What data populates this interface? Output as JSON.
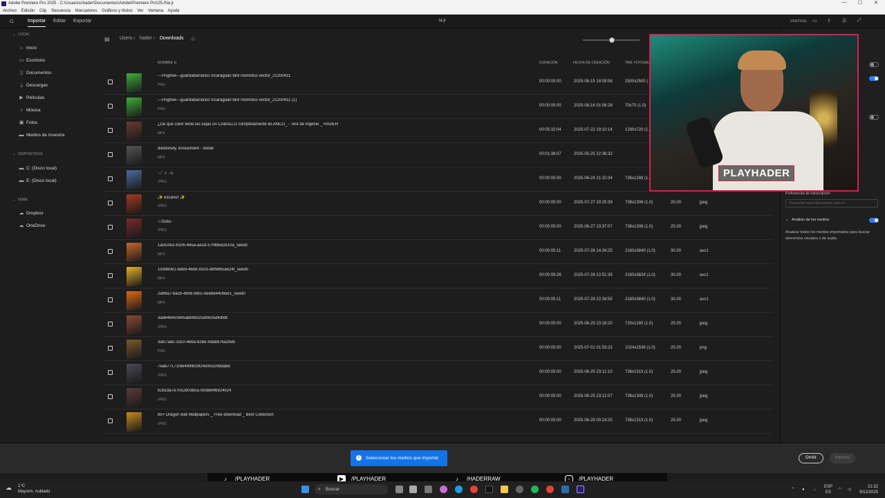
{
  "window": {
    "title": "Adobe Premiere Pro 2025 - C:\\Usuarios\\hader\\Documentos\\Adobe\\Premiere Pro\\25.0\\ia jr",
    "controls": [
      "—",
      "☐",
      "✕"
    ]
  },
  "menubar": [
    "Archivo",
    "Edición",
    "Clip",
    "Secuencia",
    "Marcadores",
    "Gráficos y títulos",
    "Ver",
    "Ventana",
    "Ayuda"
  ],
  "topbar": {
    "tabs": [
      "Importar",
      "Editar",
      "Exportar"
    ],
    "project_name": "ia jr",
    "vertical_label": "VERTICAL"
  },
  "sidebar": {
    "local_label": "LOCAL",
    "local_items": [
      {
        "label": "Inicio",
        "icon": "home-icon"
      },
      {
        "label": "Escritorio",
        "icon": "desktop-icon"
      },
      {
        "label": "Documentos",
        "icon": "document-icon"
      },
      {
        "label": "Descargas",
        "icon": "download-icon"
      },
      {
        "label": "Películas",
        "icon": "film-icon"
      },
      {
        "label": "Música",
        "icon": "music-icon"
      },
      {
        "label": "Fotos",
        "icon": "photo-icon"
      },
      {
        "label": "Medios de muestra",
        "icon": "folder-icon"
      }
    ],
    "devices_label": "DISPOSITIVOS",
    "device_items": [
      "C: (Disco local)",
      "E: (Disco local)"
    ],
    "cloud_label": "NUBE",
    "cloud_items": [
      "Dropbox",
      "OneDrive"
    ]
  },
  "breadcrumb": [
    "Users",
    "hader",
    "Downloads"
  ],
  "columns": {
    "name": "NOMBRE",
    "duration": "DURACIÓN",
    "date": "FECHA DE CREACIÓN",
    "size": "TAM. FOTOGR."
  },
  "files": [
    {
      "name": "---Pngtree---guardabarranco nicaraguan bird momotus vector_21200411",
      "type": "PNG",
      "duration": "00:00:05:00",
      "date": "2025-08-15 18:09:58",
      "size": "2500x2500 (",
      "fps": "",
      "codec": "",
      "thumb": "#3fae3a"
    },
    {
      "name": "---Pngtree---guardabarranco nicaraguan bird momotus vector_21200411 (1)",
      "type": "PNG",
      "duration": "00:00:05:00",
      "date": "2025-08-16 01:06:28",
      "size": "70x70 (1.0)",
      "fps": "",
      "codec": "",
      "thumb": "#3fae3a"
    },
    {
      "name": "¿De que color tiene las cejas un CABALLO completamente BLANCO_ - Test de Ingenio _ HADER",
      "type": "MP4",
      "duration": "00:05:32:04",
      "date": "2025-07-22 19:10:14",
      "size": "1280x720 (1.0",
      "fps": "",
      "codec": "",
      "thumb": "#6a3a2e"
    },
    {
      "name": "diedlonely, ênouement - stellar",
      "type": "MP3",
      "duration": "00:01:38:07",
      "date": "2025-05-25 22:36:32",
      "size": "",
      "fps": "",
      "codec": "",
      "thumb": "#555555"
    },
    {
      "name": "‧₊˚ ☆ ·✩",
      "type": "JPEG",
      "duration": "00:00:05:00",
      "date": "2025-06-24 21:15:34",
      "size": "736x1288 (1.0",
      "fps": "",
      "codec": "",
      "thumb": "#4a6ca0"
    },
    {
      "name": "✨ escanor ✨",
      "type": "JPEG",
      "duration": "00:00:05:00",
      "date": "2025-07-27 20:25:39",
      "size": "736x1308 (1.0)",
      "fps": "25.00",
      "codec": "jpeg",
      "thumb": "#a83a22"
    },
    {
      "name": "☆Goku",
      "type": "JPEG",
      "duration": "00:00:05:00",
      "date": "2025-06-27 23:37:07",
      "size": "736x1308 (1.0)",
      "fps": "25.00",
      "codec": "jpeg",
      "thumb": "#7a2a2a"
    },
    {
      "name": "1a0ccfe3-8106-4d5a-ae1d-57f9b6d2e10a_seed0",
      "type": "MP4",
      "duration": "00:00:05:11",
      "date": "2025-07-28 14:34:25",
      "size": "2160x3840 (1.0)",
      "fps": "30.00",
      "codec": "avc1",
      "thumb": "#c7662a"
    },
    {
      "name": "1d3db061-8a69-46b9-9103-d8f9865a624f_seed0",
      "type": "MP4",
      "duration": "00:00:09:26",
      "date": "2025-07-28 22:51:39",
      "size": "2160x3828 (1.0)",
      "fps": "30.00",
      "codec": "avc1",
      "thumb": "#e7b02a"
    },
    {
      "name": "2af6fa7-bacb-4808-89cc-deeb64406be1_seed0",
      "type": "MP4",
      "duration": "00:00:05:11",
      "date": "2025-07-28 22:34:55",
      "size": "2160x3840 (1.0)",
      "fps": "30.00",
      "codec": "avc1",
      "thumb": "#e06a12"
    },
    {
      "name": "3ad6464c0845a8b9d325d0635d4dfdb",
      "type": "JPEG",
      "duration": "00:00:05:00",
      "date": "2025-06-25 23:18:20",
      "size": "720x1280 (1.0)",
      "fps": "25.00",
      "codec": "jpeg",
      "thumb": "#8a4a32"
    },
    {
      "name": "3afc7adc-1d10-46ba-82be-4da8d76a2bd5",
      "type": "PNG",
      "duration": "00:00:05:00",
      "date": "2025-07-01 01:53:23",
      "size": "1024x1536 (1.0)",
      "fps": "25.00",
      "codec": "png",
      "thumb": "#7a5a2a"
    },
    {
      "name": "7ea877171f9e499fbc9f24e95320bdabd",
      "type": "JPEG",
      "duration": "00:00:05:00",
      "date": "2025-06-25 23:12:10",
      "size": "736x1313 (1.0)",
      "fps": "25.00",
      "codec": "jpeg",
      "thumb": "#4a4a5a"
    },
    {
      "name": "62b1da7e7052d038ca7d0d884b924024",
      "type": "JPEG",
      "duration": "00:00:05:00",
      "date": "2025-06-25 23:12:07",
      "size": "736x1308 (1.0)",
      "fps": "25.00",
      "codec": "jpeg",
      "thumb": "#5a3a3a"
    },
    {
      "name": "85+ Dragon Ball Wallpapers _ Free download _ Best Collection",
      "type": "JPEG",
      "duration": "00:00:05:00",
      "date": "2025-06-28 00:24:25",
      "size": "736x1313 (1.0)",
      "fps": "25.00",
      "codec": "jpeg",
      "thumb": "#c78a1a"
    }
  ],
  "right_panel": {
    "transcription_label": "Preferencias de transcripción",
    "transcription_placeholder": "Transcribir automáticamente solo el i...",
    "analysis_label": "Análisis de los medios",
    "analysis_desc": "Analizar todos los medios importados para buscar elementos visuales o de audio.",
    "analysis_on": true
  },
  "webcam": {
    "badge": "PLAYHADER"
  },
  "bottom": {
    "toast": "Seleccionar los medios que importar",
    "omit_button": "Omitir",
    "import_button": "Importar"
  },
  "social": [
    {
      "icon": "tiktok-icon",
      "label": "/PLAYHADER"
    },
    {
      "icon": "youtube-icon",
      "label": "/PLAYHADER"
    },
    {
      "icon": "tiktok-icon",
      "label": "/HADERRAW"
    },
    {
      "icon": "instagram-icon",
      "label": "/PLAYHADER"
    }
  ],
  "taskbar": {
    "temp": "1°C",
    "weather": "Mayorm. nublado",
    "search": "Buscar",
    "lang_top": "ESP",
    "lang_bottom": "ES",
    "time": "21:32",
    "date": "9/12/2025"
  }
}
